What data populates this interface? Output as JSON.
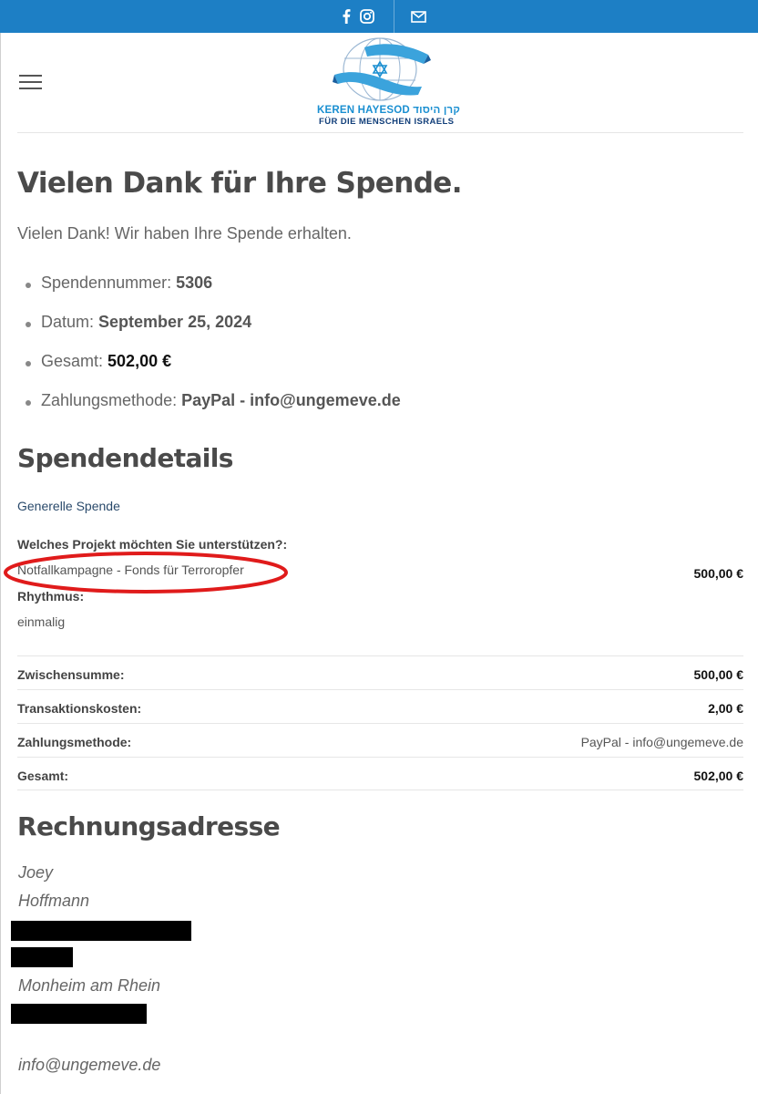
{
  "topbar": {
    "icons": [
      "facebook-icon",
      "instagram-icon",
      "mail-icon"
    ],
    "bg_color": "#1d7fc5"
  },
  "logo": {
    "line1": "KEREN HAYESOD קרן היסוד",
    "line2": "FÜR DIE MENSCHEN ISRAELS"
  },
  "page": {
    "title": "Vielen Dank für Ihre Spende.",
    "lead": "Vielen Dank! Wir haben Ihre Spende erhalten."
  },
  "summary": [
    {
      "label": "Spendennummer: ",
      "value": "5306"
    },
    {
      "label": "Datum: ",
      "value": "September 25, 2024"
    },
    {
      "label": "Gesamt: ",
      "value": "502,00 €"
    },
    {
      "label": "Zahlungsmethode: ",
      "value": "PayPal - info@ungemeve.de"
    }
  ],
  "details": {
    "heading": "Spendendetails",
    "item_name": "Generelle Spende",
    "project_label": "Welches Projekt möchten Sie unterstützen?:",
    "project_value": "Notfallkampagne - Fonds für Terroropfer",
    "rhythm_label": "Rhythmus:",
    "rhythm_value": "einmalig",
    "line_total": "500,00 €"
  },
  "totals": [
    {
      "label": "Zwischensumme:",
      "value": "500,00 €"
    },
    {
      "label": "Transaktionskosten:",
      "value": "2,00 €"
    },
    {
      "label": "Zahlungsmethode:",
      "value": "PayPal - info@ungemeve.de"
    },
    {
      "label": "Gesamt:",
      "value": "502,00 €"
    }
  ],
  "billing": {
    "heading": "Rechnungsadresse",
    "first_name": "Joey",
    "last_name": "Hoffmann",
    "city": "Monheim am Rhein",
    "email": "info@ungemeve.de"
  },
  "colors": {
    "accent": "#1d7fc5",
    "annotation": "#e01b1b"
  }
}
